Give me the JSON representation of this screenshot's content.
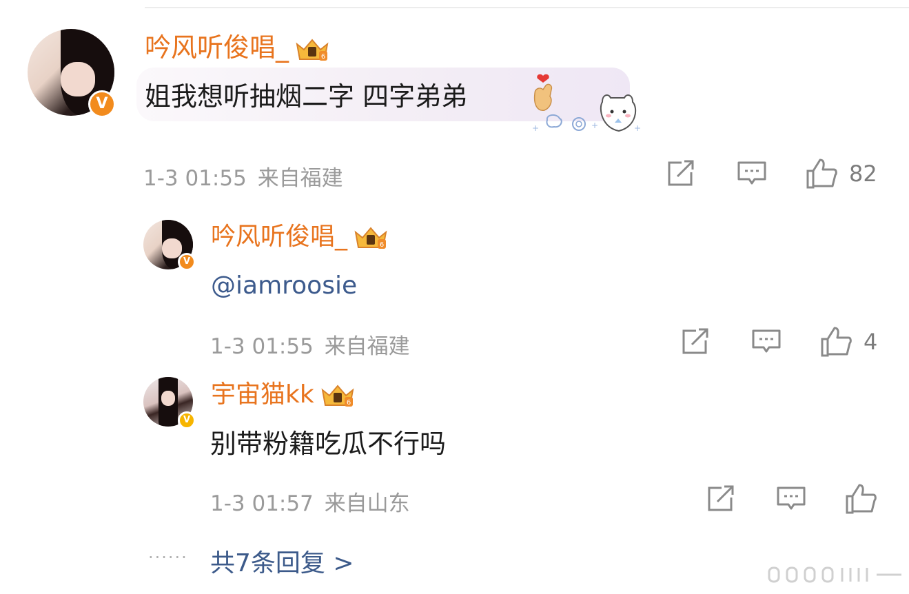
{
  "comment": {
    "username": "吟风听俊唱_",
    "text": "姐我想听抽烟二字 四字弟弟",
    "time": "1-3 01:55",
    "location": "来自福建",
    "likes": "82",
    "badge_level": "6"
  },
  "replies": [
    {
      "username": "吟风听俊唱_",
      "text": "@iamroosie",
      "time": "1-3 01:55",
      "location": "来自福建",
      "likes": "4",
      "badge_level": "6"
    },
    {
      "username": "宇宙猫kk",
      "text": "别带粉籍吃瓜不行吗",
      "time": "1-3 01:57",
      "location": "来自山东",
      "likes": "",
      "badge_level": "6"
    }
  ],
  "more_replies": {
    "dots": "······",
    "label": "共7条回复 >"
  },
  "icons": {
    "share": "share-icon",
    "reply": "comment-icon",
    "like": "thumbs-up-icon",
    "verified": "verified-badge-icon",
    "crown": "member-crown-icon"
  },
  "colors": {
    "username": "#e8741e",
    "mention": "#3d5b8d",
    "meta": "#9a9a9a",
    "verified": "#f28b1d"
  }
}
